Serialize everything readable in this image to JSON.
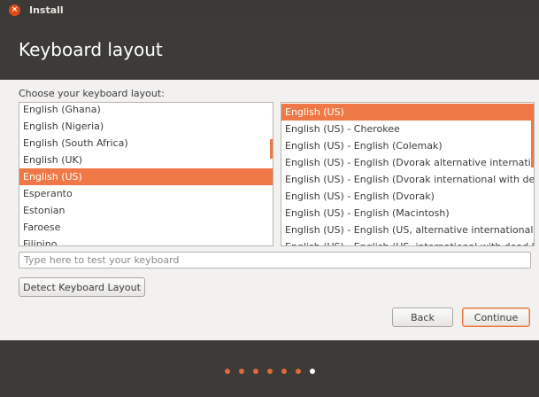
{
  "window": {
    "title": "Install"
  },
  "header": {
    "title": "Keyboard layout"
  },
  "choose_label": "Choose your keyboard layout:",
  "layouts": [
    "English (Ghana)",
    "English (Nigeria)",
    "English (South Africa)",
    "English (UK)",
    "English (US)",
    "Esperanto",
    "Estonian",
    "Faroese",
    "Filipino"
  ],
  "layouts_selected_index": 4,
  "variants": [
    "English (US)",
    "English (US) - Cherokee",
    "English (US) - English (Colemak)",
    "English (US) - English (Dvorak alternative international no dead keys)",
    "English (US) - English (Dvorak international with dead keys)",
    "English (US) - English (Dvorak)",
    "English (US) - English (Macintosh)",
    "English (US) - English (US, alternative international)",
    "English (US) - English (US, international with dead keys)"
  ],
  "variants_selected_index": 0,
  "test_input": {
    "placeholder": "Type here to test your keyboard",
    "value": ""
  },
  "buttons": {
    "detect": "Detect Keyboard Layout",
    "back": "Back",
    "continue": "Continue"
  },
  "progress": {
    "total_steps": 7,
    "current_step": 7
  },
  "colors": {
    "accent": "#f07746",
    "header_bg": "#3c3b37",
    "titlebar_bg": "#3b3a36",
    "close": "#df4a16"
  }
}
